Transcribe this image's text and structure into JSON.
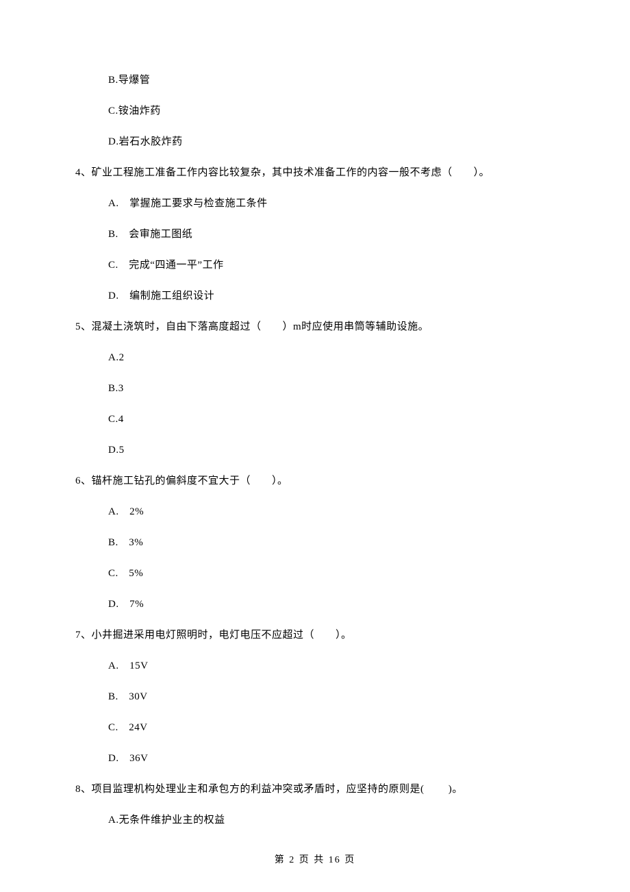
{
  "fragment": {
    "options": [
      "B.导爆管",
      "C.铵油炸药",
      "D.岩石水胶炸药"
    ]
  },
  "questions": [
    {
      "number": "4、",
      "stem": "矿业工程施工准备工作内容比较复杂，其中技术准备工作的内容一般不考虑（　　）。",
      "options": [
        "A.　掌握施工要求与检查施工条件",
        "B.　会审施工图纸",
        "C.　完成“四通一平”工作",
        "D.　编制施工组织设计"
      ]
    },
    {
      "number": "5、",
      "stem": "混凝土浇筑时，自由下落高度超过（　　）m时应使用串筒等辅助设施。",
      "options": [
        "A.2",
        "B.3",
        "C.4",
        "D.5"
      ]
    },
    {
      "number": "6、",
      "stem": "锚杆施工钻孔的偏斜度不宜大于（　　）。",
      "options": [
        "A.　2%",
        "B.　3%",
        "C.　5%",
        "D.　7%"
      ]
    },
    {
      "number": "7、",
      "stem": "小井掘进采用电灯照明时，电灯电压不应超过（　　）。",
      "options": [
        "A.　15V",
        "B.　30V",
        "C.　24V",
        "D.　36V"
      ]
    },
    {
      "number": "8、",
      "stem": "项目监理机构处理业主和承包方的利益冲突或矛盾时，应坚持的原则是(　　 )。",
      "options": [
        "A.无条件维护业主的权益"
      ]
    }
  ],
  "footer": "第 2 页 共 16 页"
}
